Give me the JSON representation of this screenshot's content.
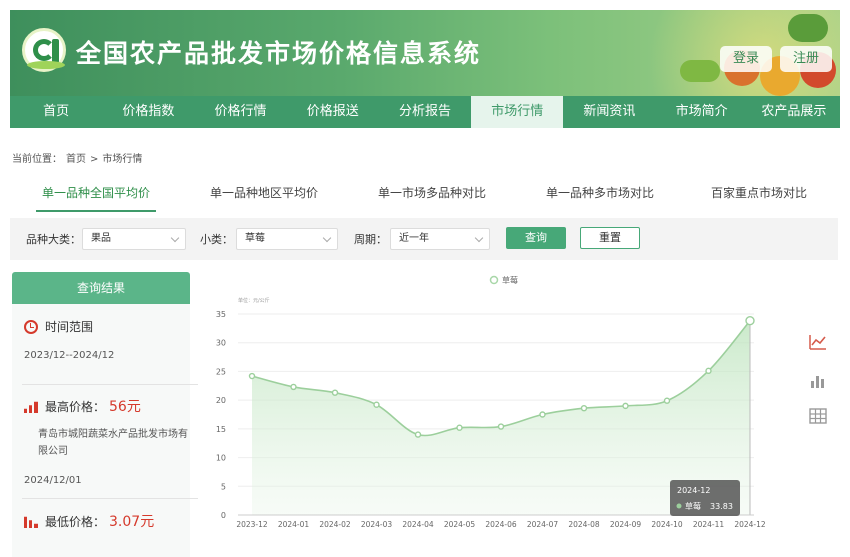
{
  "header": {
    "site_title": "全国农产品批发市场价格信息系统",
    "login": "登录",
    "register": "注册"
  },
  "nav": [
    "首页",
    "价格指数",
    "价格行情",
    "价格报送",
    "分析报告",
    "市场行情",
    "新闻资讯",
    "市场简介",
    "农产品展示"
  ],
  "nav_active": 5,
  "breadcrumb": {
    "prefix": "当前位置：",
    "home": "首页",
    "sep": ">",
    "current": "市场行情"
  },
  "subtabs": [
    "单一品种全国平均价",
    "单一品种地区平均价",
    "单一市场多品种对比",
    "单一品种多市场对比",
    "百家重点市场对比"
  ],
  "filter": {
    "category_label": "品种大类：",
    "category_value": "果品",
    "subcategory_label": "小类：",
    "subcategory_value": "草莓",
    "period_label": "周期：",
    "period_value": "近一年",
    "query": "查询",
    "reset": "重置"
  },
  "panel": {
    "title": "查询结果",
    "time_label": "时间范围",
    "time_value": "2023/12--2024/12",
    "max_label": "最高价格：",
    "max_price": "56元",
    "max_market": "青岛市城阳蔬菜水产品批发市场有限公司",
    "max_date": "2024/12/01",
    "min_label": "最低价格：",
    "min_price": "3.07元"
  },
  "icons": [
    "clock-icon",
    "bar-up-icon",
    "bar-down-icon",
    "line-chart-icon",
    "bar-chart-icon",
    "table-icon"
  ],
  "colors": {
    "nav": "#3f9a6a",
    "accent": "#47a878",
    "price": "#d53a2c"
  },
  "chart_data": {
    "type": "area",
    "legend": [
      "草莓"
    ],
    "unit_label": "单位：元/公斤",
    "x": [
      "2023-12",
      "2024-01",
      "2024-02",
      "2024-03",
      "2024-04",
      "2024-05",
      "2024-06",
      "2024-07",
      "2024-08",
      "2024-09",
      "2024-10",
      "2024-11",
      "2024-12"
    ],
    "series": [
      {
        "name": "草莓",
        "values": [
          24.2,
          22.3,
          21.3,
          19.2,
          14.0,
          15.2,
          15.4,
          17.5,
          18.6,
          19.0,
          19.9,
          25.1,
          33.83
        ]
      }
    ],
    "ylim": [
      0,
      35
    ],
    "yticks": [
      0,
      5,
      10,
      15,
      20,
      25,
      30,
      35
    ],
    "tooltip": {
      "date": "2024-12",
      "series": "草莓",
      "value": "33.83"
    }
  }
}
